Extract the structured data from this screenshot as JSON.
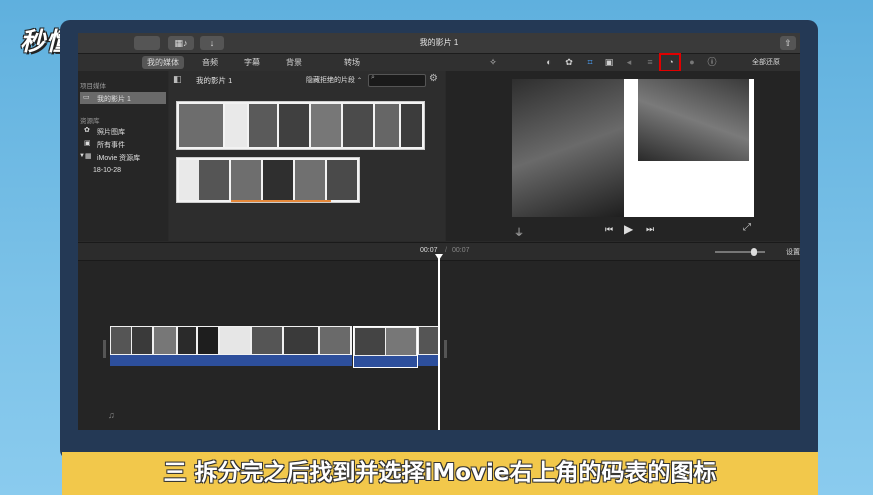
{
  "watermark": {
    "logo": "秒懂视频"
  },
  "window": {
    "title": "我的影片 1"
  },
  "toolbar": {
    "tabs": [
      "我的媒体",
      "音频",
      "字幕",
      "背景",
      "转场"
    ],
    "reset_all": "全部还原"
  },
  "sidebar": {
    "project_media_header": "项目媒体",
    "project_item": "我的影片 1",
    "library_header": "资源库",
    "photos": "照片图库",
    "all_events": "所有事件",
    "imovie_library": "iMovie 资源库",
    "event_date": "18-10-28"
  },
  "browser": {
    "title": "我的影片 1",
    "filter": "隐藏拒绝的片段",
    "search_placeholder": ""
  },
  "timeline": {
    "current_time": "00:07",
    "separator": "/",
    "total_time": "00:07",
    "settings": "设置"
  },
  "caption": {
    "text": "三 拆分完之后找到并选择iMovie右上角的码表的图标"
  },
  "colors": {
    "highlight_box": "#e00000",
    "clip_blue": "#2d4f9c",
    "caption_bg": "#f2c84b"
  }
}
